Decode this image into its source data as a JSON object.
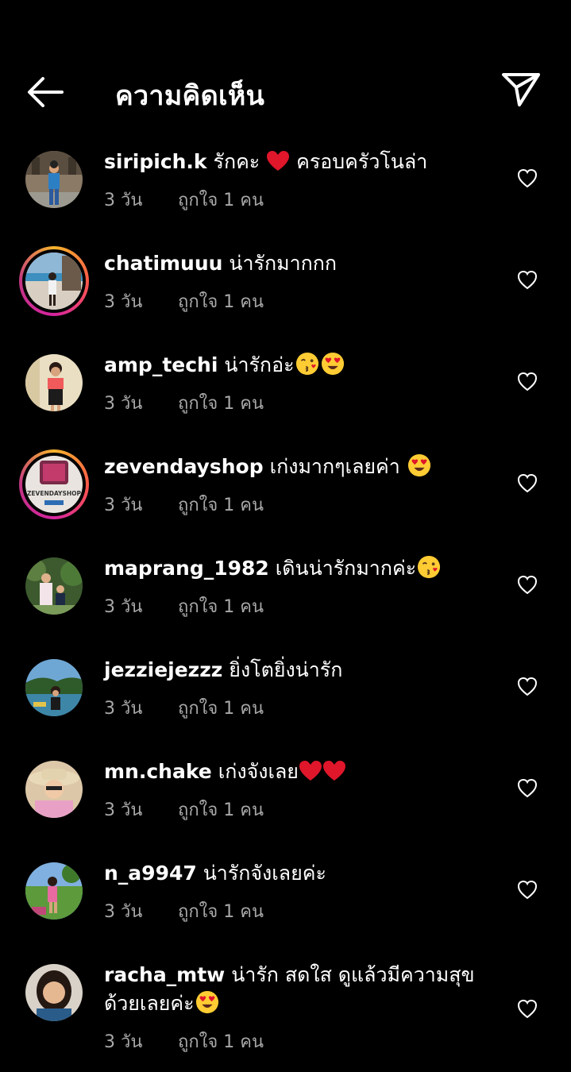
{
  "header": {
    "title": "ความคิดเห็น",
    "back_icon": "arrow-left-icon",
    "send_icon": "paper-plane-icon"
  },
  "colors": {
    "background": "#000000",
    "text": "#ffffff",
    "muted": "#a8a8a8",
    "heart_red": "#e0245e",
    "story_ring": [
      "#f7b42c",
      "#fd5949",
      "#d6249f"
    ]
  },
  "comments": [
    {
      "username": "siripich.k",
      "text_before": "รักคะ",
      "emoji": "red-heart",
      "text_after": "ครอบครัวโนล่า",
      "time": "3 วัน",
      "likes": "ถูกใจ 1 คน",
      "story_ring": false
    },
    {
      "username": "chatimuuu",
      "text_before": "น่ารักมากกก",
      "time": "3 วัน",
      "likes": "ถูกใจ 1 คน",
      "story_ring": true
    },
    {
      "username": "amp_techi",
      "text_before": "น่ารักอ่ะ",
      "emoji": "kiss-and-heart-eyes",
      "time": "3 วัน",
      "likes": "ถูกใจ 1 คน",
      "story_ring": false
    },
    {
      "username": "zevendayshop",
      "text_before": "เก่งมากๆเลยค่า",
      "emoji": "heart-eyes",
      "time": "3 วัน",
      "likes": "ถูกใจ 1 คน",
      "story_ring": true,
      "avatar_text": "ZEVENDAYSHOP"
    },
    {
      "username": "maprang_1982",
      "text_before": "เดินน่ารักมากค่ะ",
      "emoji": "kiss",
      "time": "3 วัน",
      "likes": "ถูกใจ 1 คน",
      "story_ring": false
    },
    {
      "username": "jezziejezzz",
      "text_before": "ยิ่งโตยิ่งน่ารัก",
      "time": "3 วัน",
      "likes": "ถูกใจ 1 คน",
      "story_ring": false
    },
    {
      "username": "mn.chake",
      "text_before": "เก่งจังเลย",
      "emoji": "two-red-hearts",
      "time": "3 วัน",
      "likes": "ถูกใจ 1 คน",
      "story_ring": false
    },
    {
      "username": "n_a9947",
      "text_before": "น่ารักจังเลยค่ะ",
      "time": "3 วัน",
      "likes": "ถูกใจ 1 คน",
      "story_ring": false
    },
    {
      "username": "racha_mtw",
      "text_before": "น่ารัก สดใส ดูแล้วมีความสุขด้วยเลยค่ะ",
      "emoji": "heart-eyes",
      "time": "3 วัน",
      "likes": "ถูกใจ 1 คน",
      "story_ring": false
    }
  ]
}
